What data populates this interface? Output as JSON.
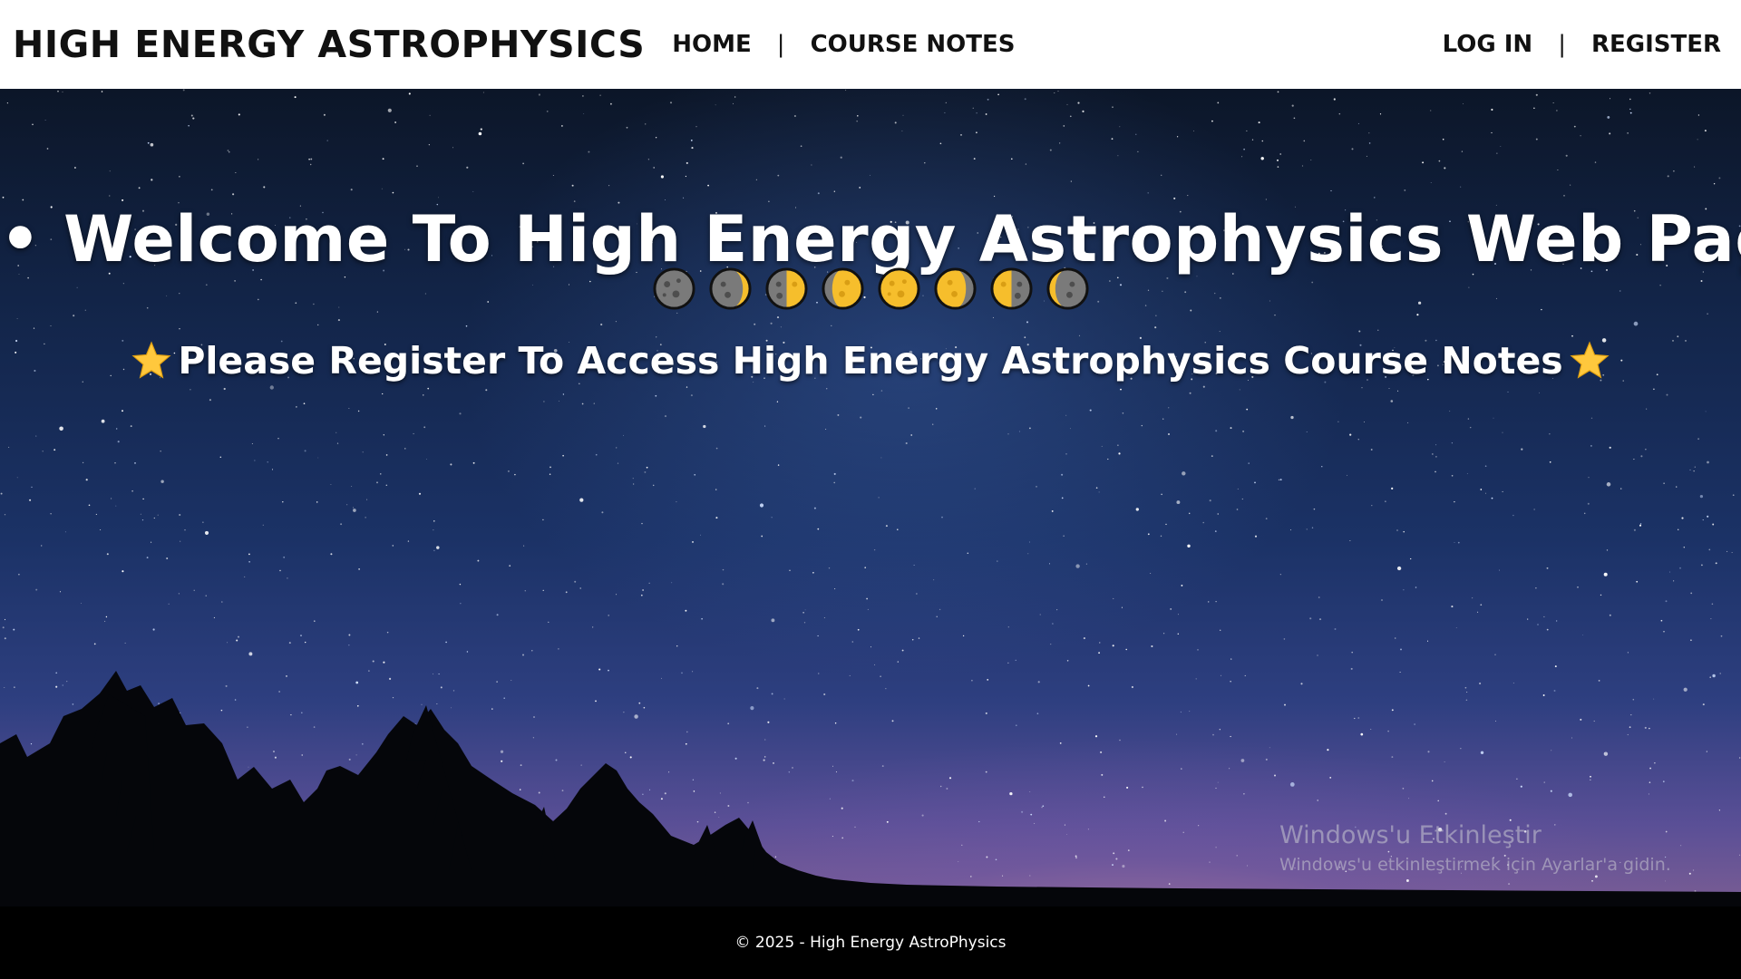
{
  "header": {
    "brand": "HIGH ENERGY ASTROPHYSICS",
    "nav_left": [
      {
        "label": "HOME"
      },
      {
        "label": "COURSE NOTES"
      }
    ],
    "nav_right": [
      {
        "label": "LOG IN"
      },
      {
        "label": "REGISTER"
      }
    ],
    "separator": "|"
  },
  "hero": {
    "title": "• Welcome To High Energy Astrophysics Web Page •",
    "moon_phases": [
      "new-moon-icon",
      "waxing-crescent-moon-icon",
      "first-quarter-moon-icon",
      "waxing-gibbous-moon-icon",
      "full-moon-icon",
      "waning-gibbous-moon-icon",
      "last-quarter-moon-icon",
      "waning-crescent-moon-icon"
    ],
    "subtitle": "Please Register To Access High Energy Astrophysics Course Notes",
    "subtitle_icon": "star-icon"
  },
  "watermark": {
    "title": "Windows'u Etkinleştir",
    "subtitle": "Windows'u etkinleştirmek için Ayarlar'a gidin."
  },
  "footer": {
    "text": "© 2025 - High Energy AstroPhysics"
  },
  "colors": {
    "navbar_bg": "#ffffff",
    "moon_lit": "#f6be2c",
    "moon_dark": "#7a7a7a",
    "star": "#ffc83d",
    "footer_bg": "#000000"
  }
}
